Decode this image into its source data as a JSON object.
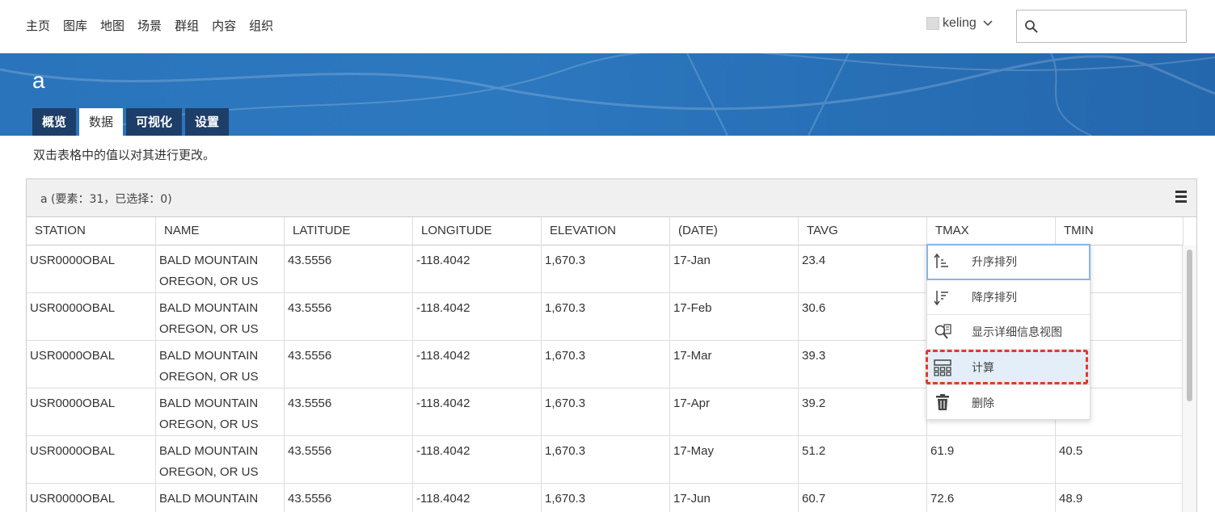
{
  "nav": {
    "links": [
      "主页",
      "图库",
      "地图",
      "场景",
      "群组",
      "内容",
      "组织"
    ],
    "user": "keling",
    "search_placeholder": ""
  },
  "banner": {
    "title": "a",
    "tabs": [
      {
        "label": "概览",
        "active": false
      },
      {
        "label": "数据",
        "active": true
      },
      {
        "label": "可视化",
        "active": false
      },
      {
        "label": "设置",
        "active": false
      }
    ]
  },
  "hint": "双击表格中的值以对其进行更改。",
  "table": {
    "title": "a (要素：31，已选择：0)",
    "columns": [
      "STATION",
      "NAME",
      "LATITUDE",
      "LONGITUDE",
      "ELEVATION",
      "(DATE)",
      "TAVG",
      "TMAX",
      "TMIN"
    ],
    "rows": [
      [
        "USR0000OBAL",
        "BALD MOUNTAIN OREGON, OR US",
        "43.5556",
        "-118.4042",
        "1,670.3",
        "17-Jan",
        "23.4",
        "",
        ""
      ],
      [
        "USR0000OBAL",
        "BALD MOUNTAIN OREGON, OR US",
        "43.5556",
        "-118.4042",
        "1,670.3",
        "17-Feb",
        "30.6",
        "",
        ""
      ],
      [
        "USR0000OBAL",
        "BALD MOUNTAIN OREGON, OR US",
        "43.5556",
        "-118.4042",
        "1,670.3",
        "17-Mar",
        "39.3",
        "",
        ""
      ],
      [
        "USR0000OBAL",
        "BALD MOUNTAIN OREGON, OR US",
        "43.5556",
        "-118.4042",
        "1,670.3",
        "17-Apr",
        "39.2",
        "",
        ""
      ],
      [
        "USR0000OBAL",
        "BALD MOUNTAIN OREGON, OR US",
        "43.5556",
        "-118.4042",
        "1,670.3",
        "17-May",
        "51.2",
        "61.9",
        "40.5"
      ],
      [
        "USR0000OBAL",
        "BALD MOUNTAIN",
        "43.5556",
        "-118.4042",
        "1,670.3",
        "17-Jun",
        "60.7",
        "72.6",
        "48.9"
      ]
    ]
  },
  "context_menu": {
    "items": [
      {
        "label": "升序排列",
        "icon": "sort-ascending-icon"
      },
      {
        "label": "降序排列",
        "icon": "sort-descending-icon"
      },
      {
        "label": "显示详细信息视图",
        "icon": "detail-view-icon"
      },
      {
        "label": "计算",
        "icon": "calculator-icon"
      },
      {
        "label": "删除",
        "icon": "trash-icon"
      }
    ]
  },
  "colors": {
    "banner": "#2a74bb",
    "tab_dark": "#1d3e68",
    "highlight_dash": "#e03a2f"
  }
}
